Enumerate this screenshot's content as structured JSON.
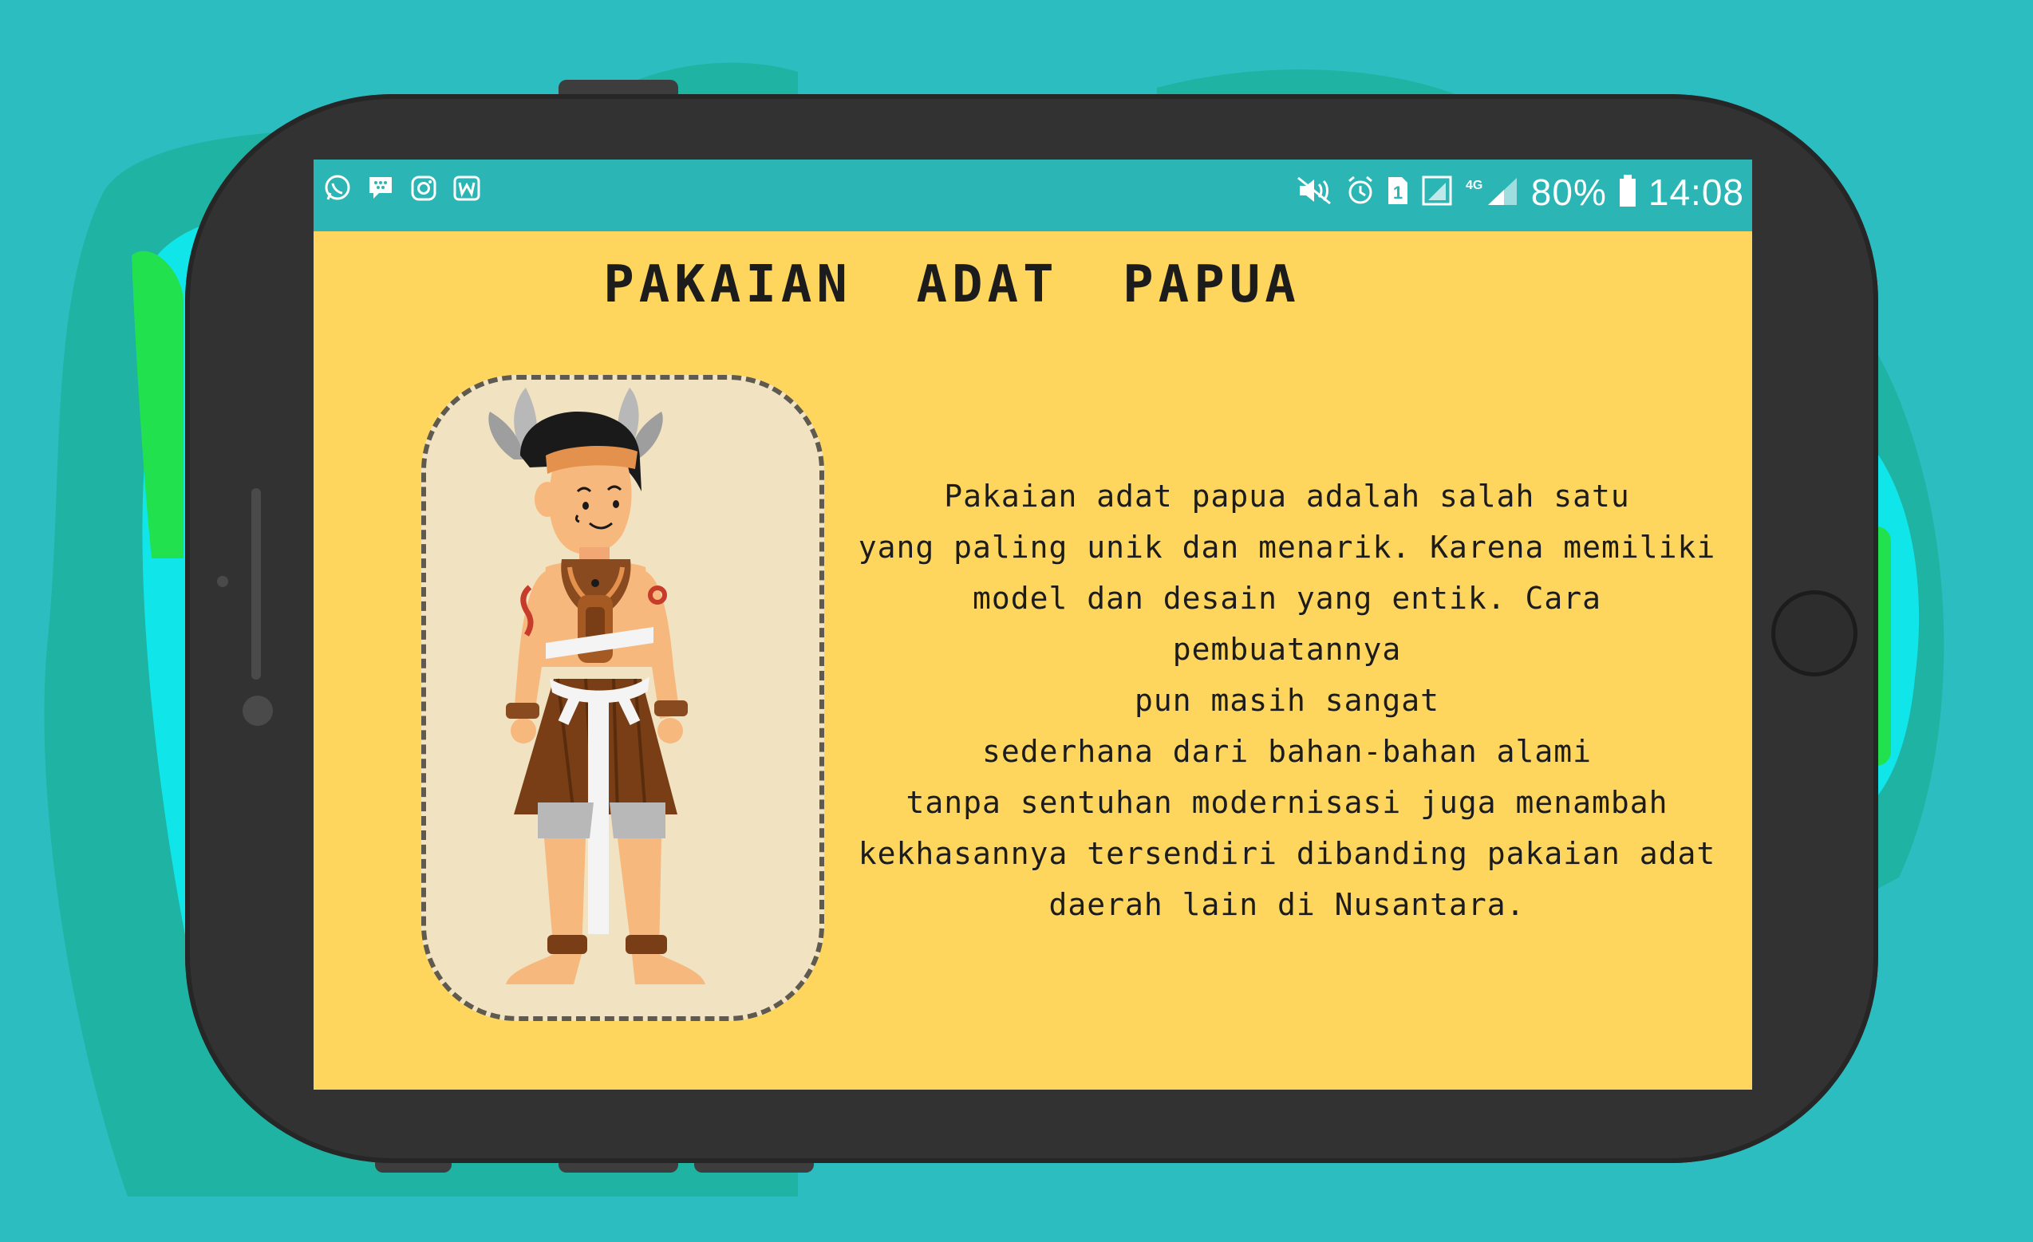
{
  "status_bar": {
    "app_icons": [
      "whatsapp-icon",
      "bbm-icon",
      "instagram-icon",
      "wattpad-icon"
    ],
    "battery": "80%",
    "time": "14:08",
    "network": "4G"
  },
  "page": {
    "title": "PAKAIAN ADAT PAPUA",
    "description": "Pakaian adat papua adalah salah satu\nyang paling unik dan menarik. Karena memiliki\nmodel dan desain yang entik. Cara pembuatannya\npun masih sangat\nsederhana dari bahan-bahan alami\ntanpa sentuhan modernisasi juga menambah\nkekhasannya tersendiri dibanding pakaian adat\ndaerah lain di Nusantara."
  },
  "colors": {
    "background": "#2bbdc0",
    "phone_body": "#323232",
    "status_bar": "#2bb5b5",
    "screen": "#fed65e",
    "card": "#f1e3c1"
  }
}
